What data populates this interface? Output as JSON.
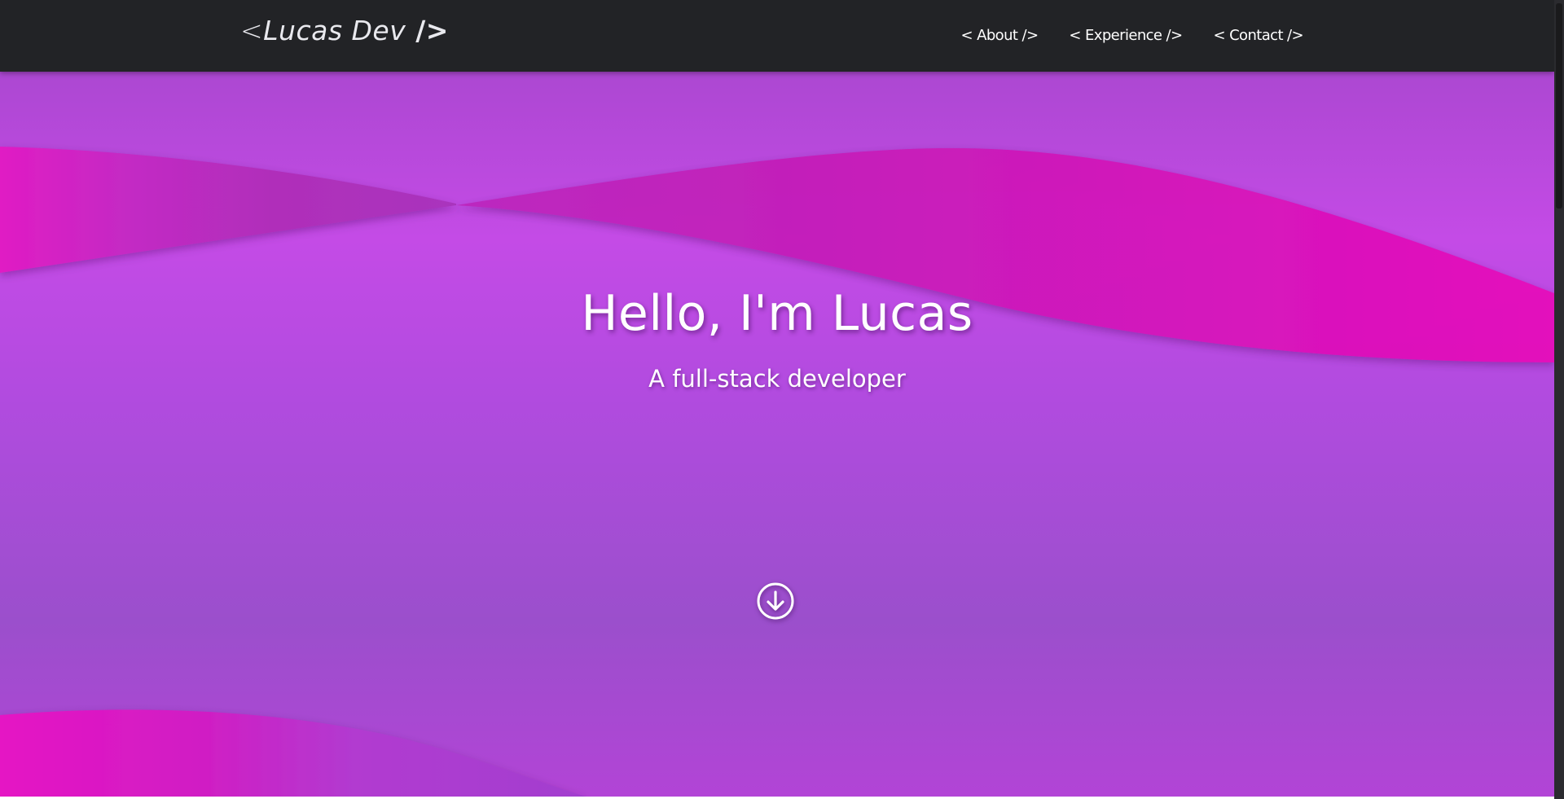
{
  "navbar": {
    "brand": {
      "open": "<",
      "name": "Lucas Dev",
      "close": " />"
    },
    "links": [
      {
        "label": "< About />"
      },
      {
        "label": "< Experience />"
      },
      {
        "label": "< Contact />"
      }
    ]
  },
  "hero": {
    "title": "Hello, I'm Lucas",
    "subtitle": "A full-stack developer",
    "scroll_icon": "arrow-down-circle-icon"
  },
  "colors": {
    "navbar_bg": "#222326",
    "hero_purple": "#c44be6",
    "hero_violet": "#9b4fcc",
    "wave_magenta": "#e016c0"
  }
}
